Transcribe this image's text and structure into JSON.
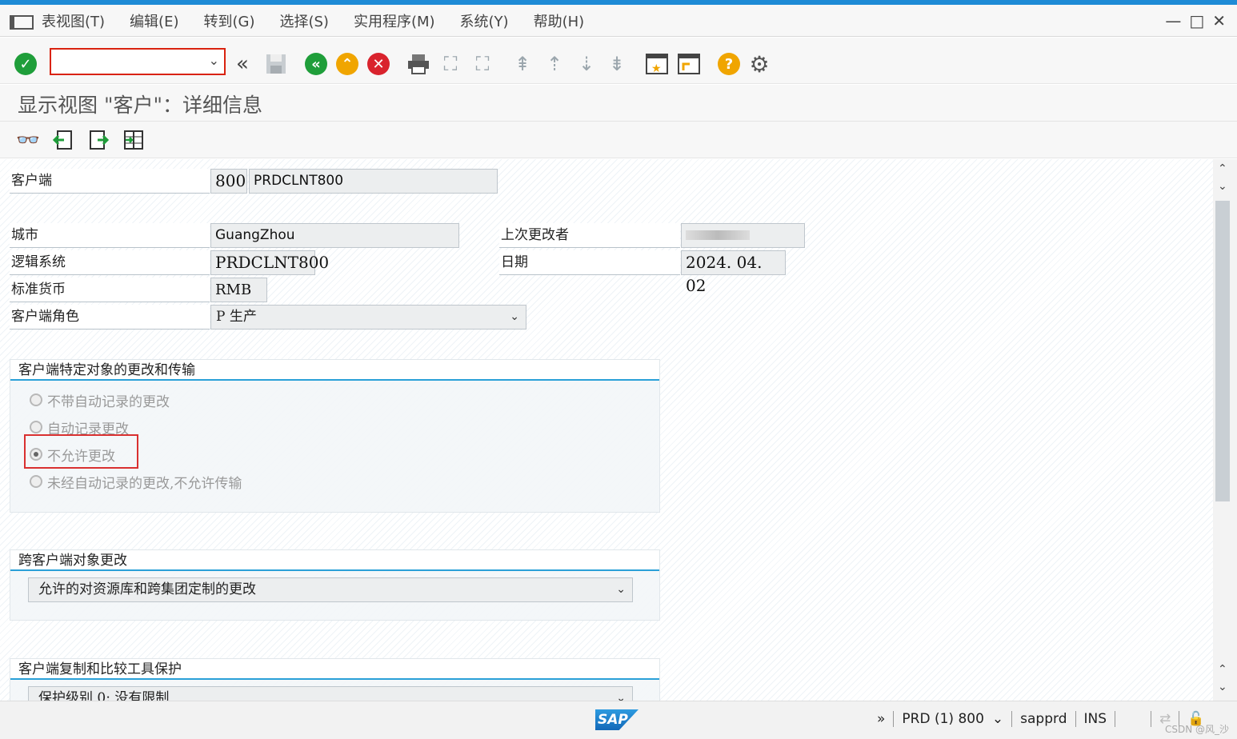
{
  "menu": {
    "items": [
      "表视图(T)",
      "编辑(E)",
      "转到(G)",
      "选择(S)",
      "实用程序(M)",
      "系统(Y)",
      "帮助(H)"
    ]
  },
  "window_controls": {
    "minimize": "—",
    "maximize": "□",
    "close": "✕"
  },
  "toolbar": {
    "command_field": {
      "value": ""
    }
  },
  "page": {
    "title": "显示视图 \"客户\"：详细信息"
  },
  "form": {
    "client": {
      "label": "客户端",
      "number": "800",
      "name": "PRDCLNT800"
    },
    "city": {
      "label": "城市",
      "value": "GuangZhou"
    },
    "last_changed_by": {
      "label": "上次更改者",
      "value": ""
    },
    "logical_system": {
      "label": "逻辑系统",
      "value": "PRDCLNT800"
    },
    "date": {
      "label": "日期",
      "value": "2024. 04. 02"
    },
    "currency": {
      "label": "标准货币",
      "value": "RMB"
    },
    "client_role": {
      "label": "客户端角色",
      "value": "P 生产"
    }
  },
  "groups": {
    "client_specific": {
      "title": "客户端特定对象的更改和传输",
      "options": [
        "不带自动记录的更改",
        "自动记录更改",
        "不允许更改",
        "未经自动记录的更改,不允许传输"
      ],
      "selected_index": 2
    },
    "cross_client": {
      "title": "跨客户端对象更改",
      "value": "允许的对资源库和跨集团定制的更改"
    },
    "copy_protection": {
      "title": "客户端复制和比较工具保护",
      "value": "保护级别 0: 没有限制"
    }
  },
  "status": {
    "logo": "SAP",
    "more": "»",
    "system": "PRD (1) 800",
    "server": "sapprd",
    "mode": "INS"
  },
  "watermark": "CSDN @风_沙"
}
